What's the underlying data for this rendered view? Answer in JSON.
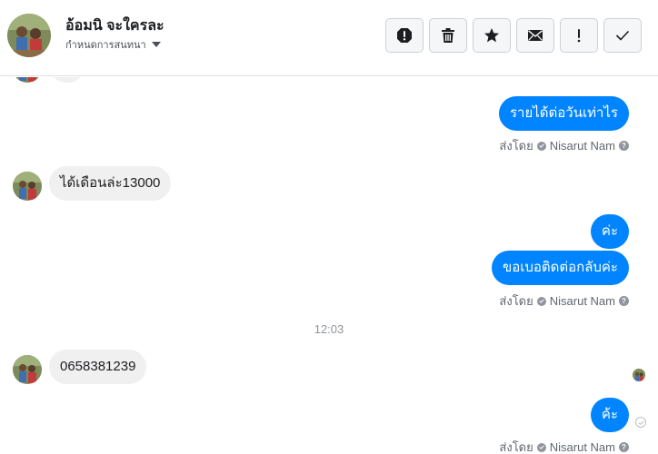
{
  "header": {
    "contact_name": "อ้อมนิ จะใครละ",
    "subtitle": "กำหนดการสนทนา",
    "actions": [
      {
        "name": "report",
        "icon": "exclamation-circle-icon"
      },
      {
        "name": "delete",
        "icon": "trash-icon"
      },
      {
        "name": "star",
        "icon": "star-icon"
      },
      {
        "name": "mark-unread",
        "icon": "envelope-icon"
      },
      {
        "name": "flag",
        "icon": "exclamation-icon"
      },
      {
        "name": "done",
        "icon": "checkmark-icon"
      }
    ]
  },
  "thread": {
    "messages": [
      {
        "direction": "out",
        "text": "รายได้ต่อวันเท่าไร"
      },
      {
        "direction": "in",
        "text": "ได้เดือนล่ะ13000"
      },
      {
        "direction": "out",
        "text": "ค่ะ"
      },
      {
        "direction": "out",
        "text": "ขอเบอติดต่อกลับค่ะ"
      },
      {
        "direction": "in",
        "text": "0658381239"
      },
      {
        "direction": "out",
        "text": "ค้ะ"
      }
    ],
    "sent_by_prefix": "ส่งโดย",
    "sent_by_name": "Nisarut Nam",
    "help_glyph": "?",
    "time_divider": "12:03"
  },
  "colors": {
    "accent": "#0084ff",
    "incoming_bubble": "#f1f0f0",
    "meta_text": "#606770"
  }
}
